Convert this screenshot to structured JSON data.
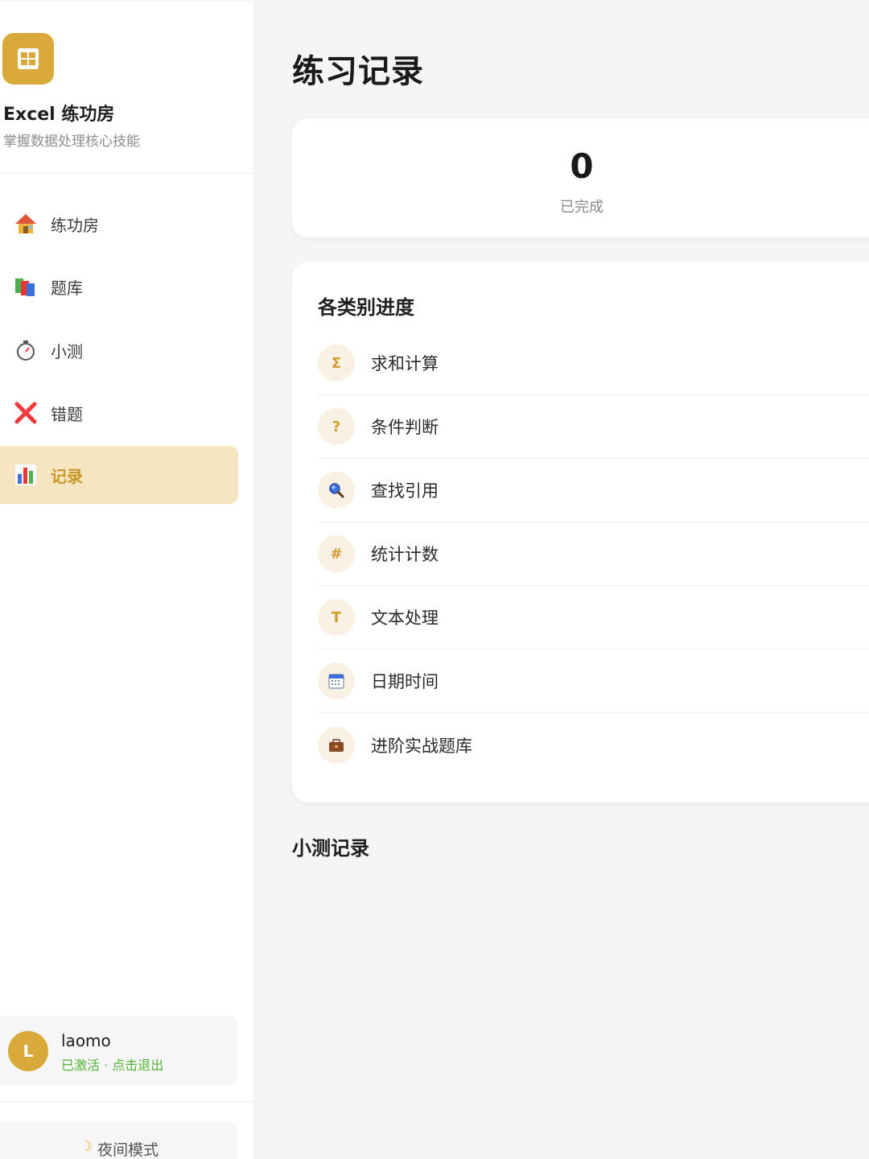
{
  "brand": {
    "title": "Excel 练功房",
    "subtitle": "掌握数据处理核心技能",
    "logo_icon": "grid-icon",
    "accent_color": "#d9a93a"
  },
  "nav": {
    "items": [
      {
        "label": "练功房",
        "icon": "house-icon"
      },
      {
        "label": "题库",
        "icon": "books-icon"
      },
      {
        "label": "小测",
        "icon": "stopwatch-icon"
      },
      {
        "label": "错题",
        "icon": "cross-mark-icon"
      },
      {
        "label": "记录",
        "icon": "bar-chart-icon",
        "active": true
      }
    ]
  },
  "user": {
    "avatar_letter": "L",
    "name": "laomo",
    "status": "已激活 · 点击退出"
  },
  "night_mode": {
    "label": "夜间模式",
    "icon": "moon-icon"
  },
  "main": {
    "title": "练习记录",
    "stat": {
      "value": "0",
      "label": "已完成"
    },
    "categories_title": "各类别进度",
    "categories": [
      {
        "label": "求和计算",
        "icon": "sigma-icon",
        "glyph": "Σ"
      },
      {
        "label": "条件判断",
        "icon": "question-icon",
        "glyph": "?"
      },
      {
        "label": "查找引用",
        "icon": "magnifier-icon",
        "glyph": ""
      },
      {
        "label": "统计计数",
        "icon": "hash-icon",
        "glyph": "#"
      },
      {
        "label": "文本处理",
        "icon": "text-icon",
        "glyph": "T"
      },
      {
        "label": "日期时间",
        "icon": "calendar-icon",
        "glyph": ""
      },
      {
        "label": "进阶实战题库",
        "icon": "briefcase-icon",
        "glyph": ""
      }
    ],
    "quiz_title": "小测记录"
  }
}
